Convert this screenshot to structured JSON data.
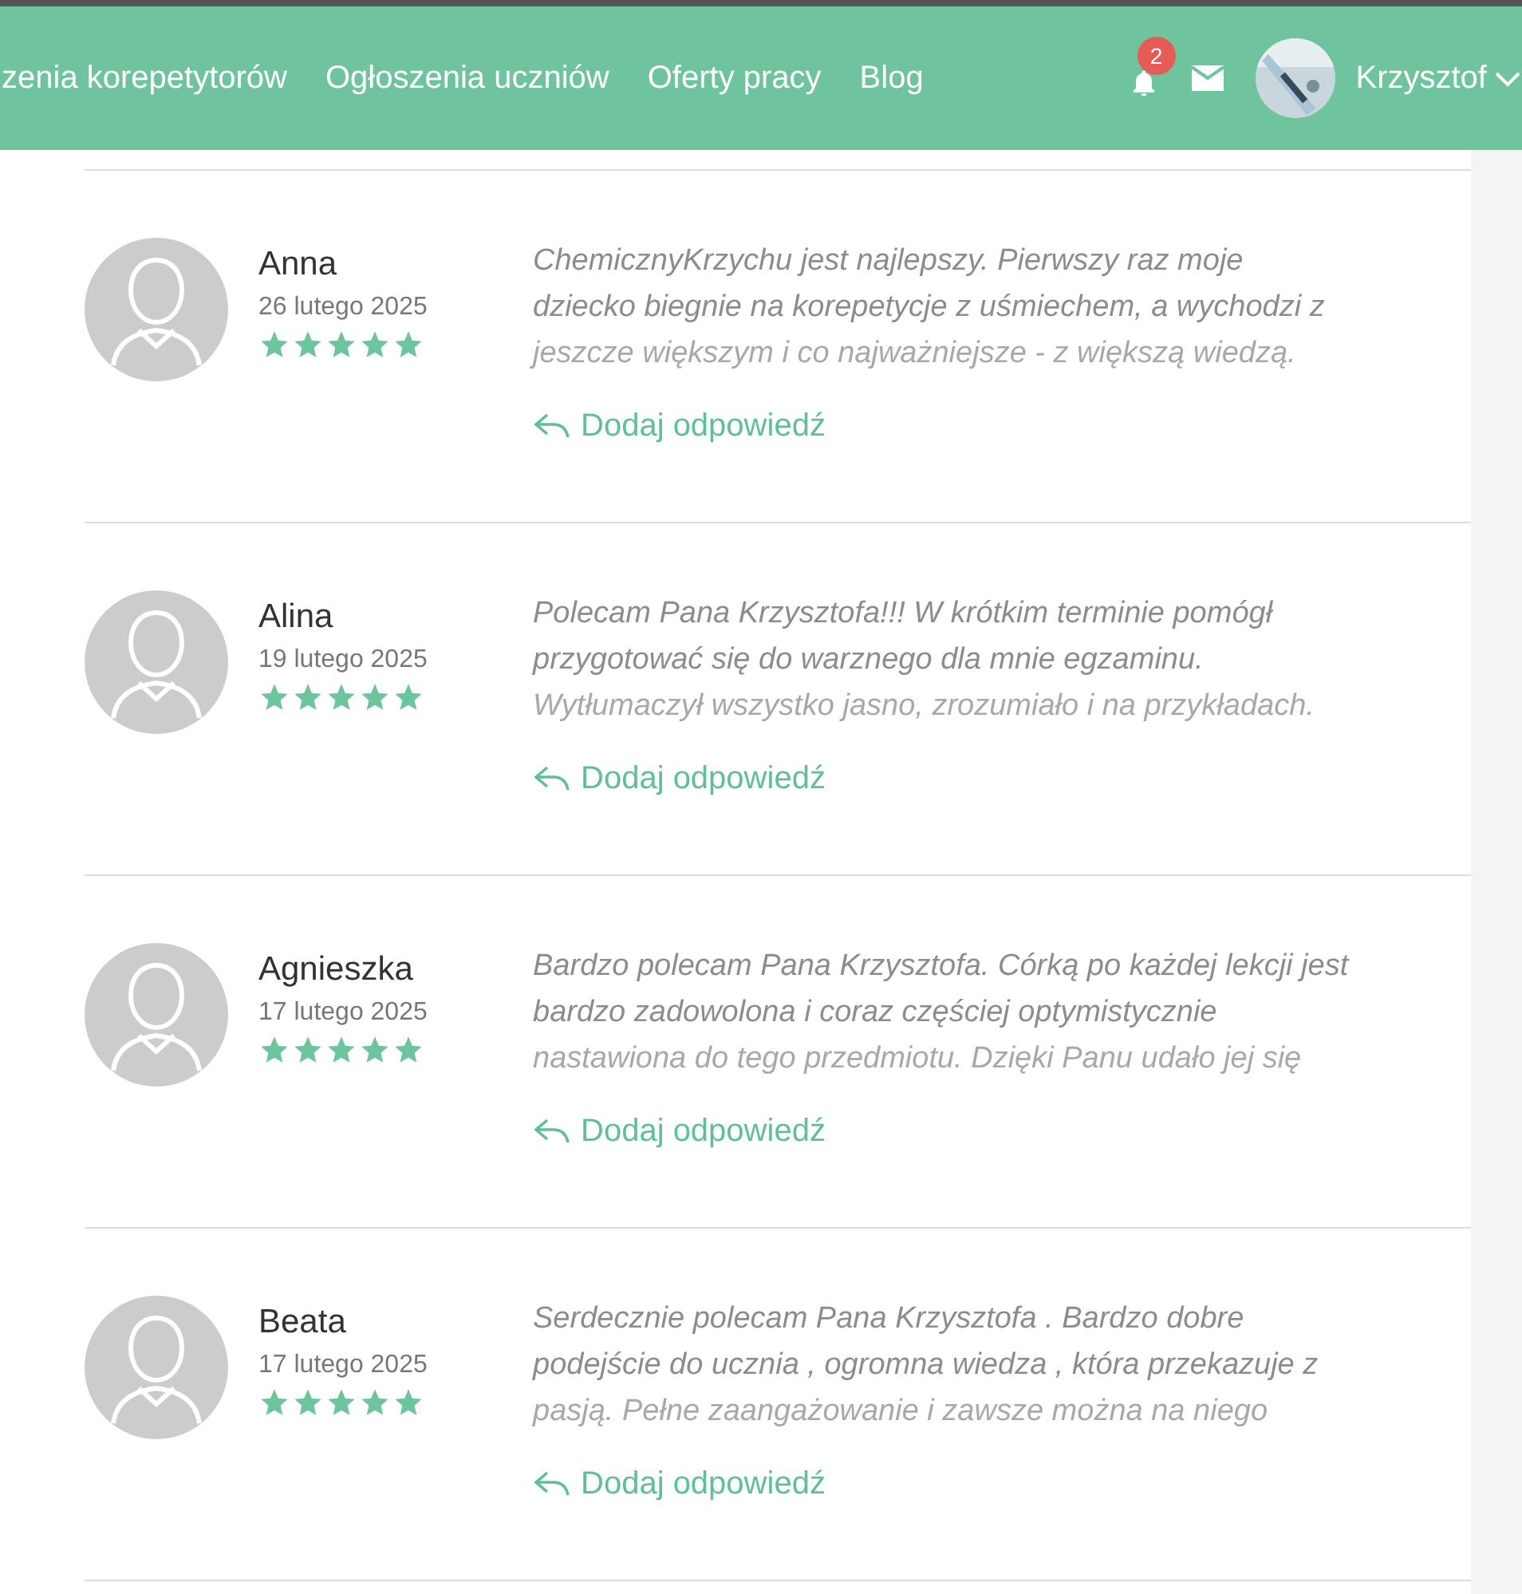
{
  "nav": {
    "links": [
      "zenia korepetytorów",
      "Ogłoszenia uczniów",
      "Oferty pracy",
      "Blog"
    ],
    "notifications": "2",
    "user": "Krzysztof"
  },
  "reviews": [
    {
      "name": "Anna",
      "date": "26 lutego 2025",
      "stars": 5,
      "lines": [
        "ChemicznyKrzychu jest najlepszy. Pierwszy raz moje",
        "dziecko biegnie na korepetycje z uśmiechem, a wychodzi z",
        "jeszcze większym i co najważniejsze - z większą wiedzą."
      ],
      "reply": "Dodaj odpowiedź"
    },
    {
      "name": "Alina",
      "date": "19 lutego 2025",
      "stars": 5,
      "lines": [
        "Polecam Pana Krzysztofa!!! W krótkim terminie pomógł",
        "przygotować się do warznego dla mnie egzaminu.",
        "Wytłumaczył wszystko jasno, zrozumiało i na przykładach."
      ],
      "reply": "Dodaj odpowiedź"
    },
    {
      "name": "Agnieszka",
      "date": "17 lutego 2025",
      "stars": 5,
      "lines": [
        "Bardzo polecam Pana Krzysztofa. Córką po każdej lekcji jest",
        "bardzo zadowolona i coraz częściej optymistycznie",
        "nastawiona do tego przedmiotu. Dzięki Panu udało jej się"
      ],
      "reply": "Dodaj odpowiedź"
    },
    {
      "name": "Beata",
      "date": "17 lutego 2025",
      "stars": 5,
      "lines": [
        "Serdecznie polecam Pana Krzysztofa . Bardzo dobre",
        "podejście do ucznia , ogromna wiedza , która przekazuje z",
        "pasją. Pełne zaangażowanie i zawsze można na niego"
      ],
      "reply": "Dodaj odpowiedź"
    }
  ]
}
